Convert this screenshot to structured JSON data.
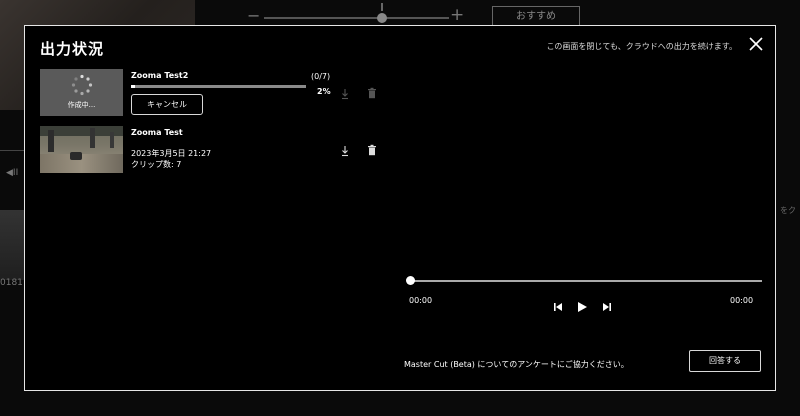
{
  "background": {
    "recommend_label": "おすすめ",
    "zoom_minus": "−",
    "zoom_plus": "+",
    "left_control": "◀II",
    "clip_number": "0181",
    "right_text": "をク"
  },
  "modal": {
    "title": "出力状況",
    "notice": "この画面を閉じても、クラウドへの出力を続けます。",
    "close_icon": "close-icon"
  },
  "jobs": [
    {
      "name": "Zooma Test2",
      "status_label": "作成中...",
      "count": "(0/7)",
      "percent": "2%",
      "progress": 0.02,
      "cancel_label": "キャンセル"
    },
    {
      "name": "Zooma Test",
      "date": "2023年3月5日 21:27",
      "clips": "クリップ数: 7"
    }
  ],
  "player": {
    "time_current": "00:00",
    "time_total": "00:00",
    "position": 0
  },
  "survey": {
    "text": "Master Cut (Beta) についてのアンケートにご協力ください。",
    "button_label": "回答する"
  },
  "colors": {
    "modal_bg": "#000000",
    "modal_border": "#e6e6e6",
    "thumb_creating_bg": "#5a5a5a",
    "disabled_icon": "#555555",
    "active_icon": "#dddddd"
  }
}
